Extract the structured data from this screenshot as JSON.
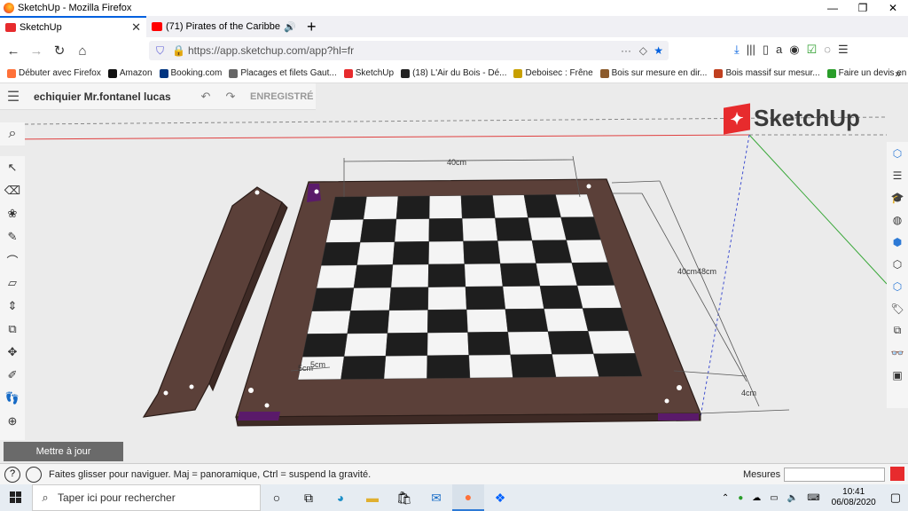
{
  "browser": {
    "window_title": "SketchUp - Mozilla Firefox",
    "window_controls": [
      "—",
      "❐",
      "✕"
    ],
    "tabs": [
      {
        "label": "SketchUp",
        "close": "✕"
      },
      {
        "label": "(71) Pirates of the Caribbean"
      }
    ],
    "new_tab": "+",
    "url": "https://app.sketchup.com/app?hl=fr",
    "bookmarks": [
      {
        "label": "Débuter avec Firefox",
        "color": "#ff7139"
      },
      {
        "label": "Amazon",
        "color": "#111111"
      },
      {
        "label": "Booking.com",
        "color": "#003580"
      },
      {
        "label": "Placages et filets Gaut...",
        "color": "#666666"
      },
      {
        "label": "SketchUp",
        "color": "#e72b2d"
      },
      {
        "label": "(18) L'Air du Bois - Dé...",
        "color": "#222222"
      },
      {
        "label": "Deboisec : Frêne",
        "color": "#c8a000"
      },
      {
        "label": "Bois sur mesure en dir...",
        "color": "#8b5a2b"
      },
      {
        "label": "Bois massif sur mesur...",
        "color": "#c04020"
      },
      {
        "label": "Faire un devis en ligne...",
        "color": "#2a9d2a"
      }
    ],
    "bookmarks_more": "»"
  },
  "sketchup": {
    "model_title": "echiquier Mr.fontanel lucas",
    "saved_label": "ENREGISTRÉ",
    "logo_text": "SketchUp",
    "update_button": "Mettre à jour",
    "status_message": "Faites glisser pour naviguer. Maj = panoramique, Ctrl = suspend la gravité.",
    "measures_label": "Mesures",
    "dimensions": {
      "top_width": "40cm",
      "right_depth": "40cm48cm",
      "frame_width": "4cm",
      "corner_a": "5cm",
      "corner_b": "5cm"
    },
    "colors": {
      "wood": "#5b4039",
      "dark_square": "#1e1e1e",
      "light_square": "#f4f4f4",
      "accent": "#e72b2d"
    }
  },
  "taskbar": {
    "search_placeholder": "Taper ici pour rechercher",
    "time": "10:41",
    "date": "06/08/2020"
  }
}
